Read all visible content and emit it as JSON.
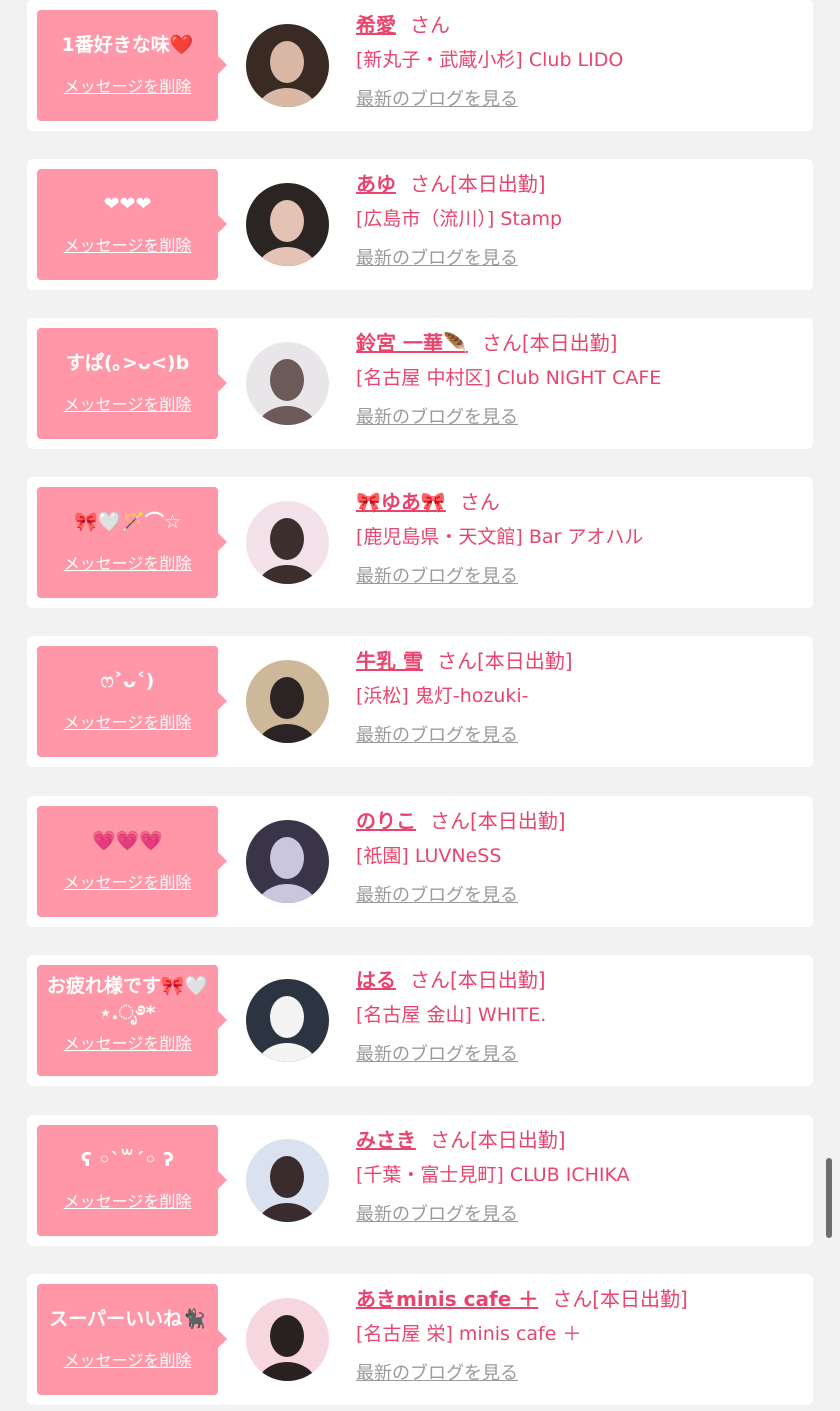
{
  "honorific": "さん",
  "delete_label": "メッセージを削除",
  "blog_label": "最新のブログを見る",
  "colors": {
    "background": "#f2f2f2",
    "bubble": "#ff97a8",
    "name": "#e8456e",
    "blog_link": "#9a9a9a"
  },
  "items": [
    {
      "message": "1番好きな味❤️",
      "name": "希愛",
      "status": "",
      "shop": "[新丸子・武蔵小杉] Club LIDO",
      "avatar_colors": [
        "#3a2a24",
        "#d9b8a6"
      ]
    },
    {
      "message": "❤❤❤",
      "name": "あゆ",
      "status": "[本日出勤]",
      "shop": "[広島市（流川）] Stamp",
      "avatar_colors": [
        "#2a2422",
        "#e4c2b4"
      ]
    },
    {
      "message": "すぱ(｡>ᴗ<)b",
      "name": "鈴宮 一華🪶",
      "status": "[本日出勤]",
      "shop": "[名古屋 中村区] Club NIGHT CAFE",
      "avatar_colors": [
        "#e9e6ea",
        "#6b5a57"
      ]
    },
    {
      "message": "🎀🤍🪄⌒☆",
      "name": "🎀ゆあ🎀",
      "status": "",
      "shop": "[鹿児島県・天文館] Bar アオハル",
      "avatar_colors": [
        "#f3e2ea",
        "#3d2e2e"
      ]
    },
    {
      "message": "ෆ˃ᴗ˂)",
      "name": "牛乳 雪",
      "status": "[本日出勤]",
      "shop": "[浜松] 鬼灯-hozuki-",
      "avatar_colors": [
        "#cdb89a",
        "#2c2424"
      ]
    },
    {
      "message": "💗💗💗",
      "name": "のりこ",
      "status": "[本日出勤]",
      "shop": "[祇園] LUVNeSS",
      "avatar_colors": [
        "#3a3448",
        "#c9c6de"
      ]
    },
    {
      "message": "お疲れ様です🎀🤍⋆.ೃ࿔*",
      "name": "はる",
      "status": "[本日出勤]",
      "shop": "[名古屋 金山] WHITE.",
      "avatar_colors": [
        "#2b3440",
        "#f4f4f4"
      ]
    },
    {
      "message": "ʕ ◦`꒳´◦ ʔ",
      "name": "みさき",
      "status": "[本日出勤]",
      "shop": "[千葉・富士見町] CLUB ICHIKA",
      "avatar_colors": [
        "#d9e2ee",
        "#3a2c2c"
      ]
    },
    {
      "message": "スーパーいいね🐈‍⬛",
      "name": "あきminis cafe ＋",
      "status": "[本日出勤]",
      "shop": "[名古屋 栄] minis cafe ＋",
      "avatar_colors": [
        "#f6d7e0",
        "#2a2222"
      ]
    }
  ]
}
